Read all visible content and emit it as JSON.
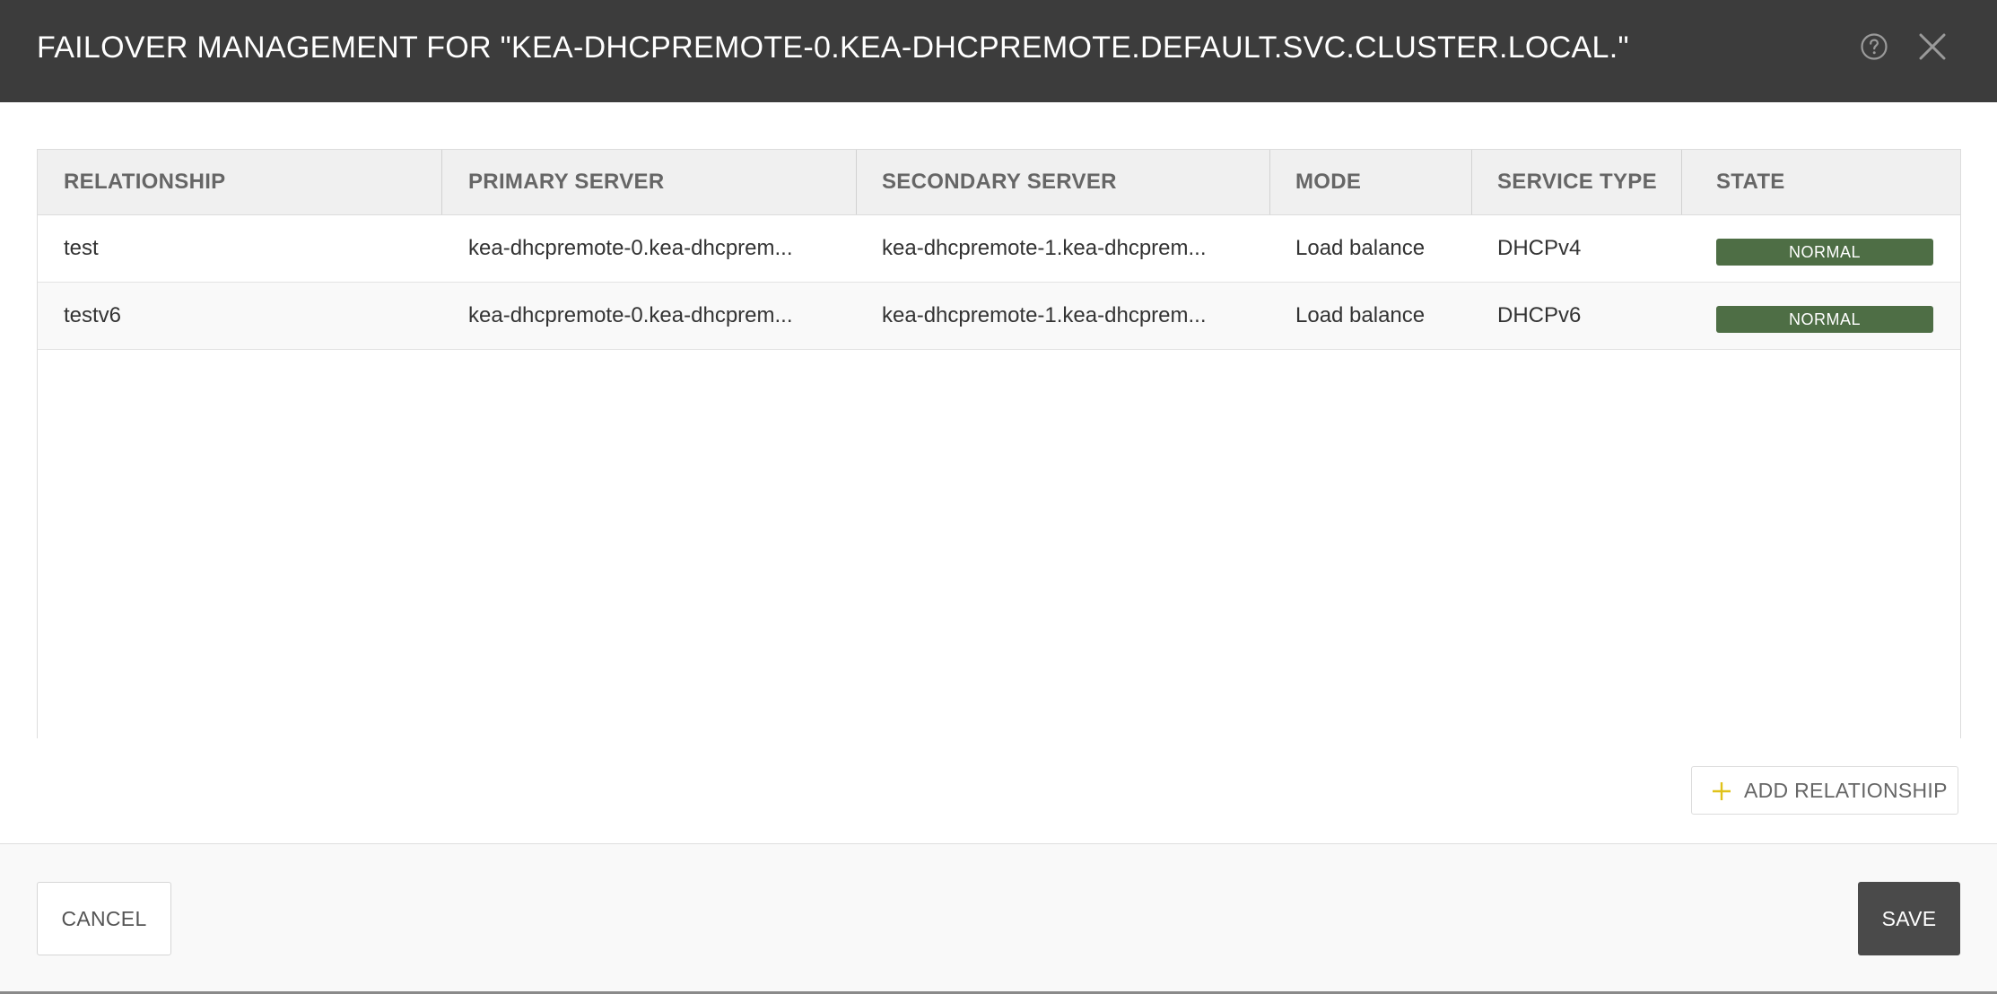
{
  "dialog": {
    "title": "FAILOVER MANAGEMENT FOR \"KEA-DHCPREMOTE-0.KEA-DHCPREMOTE.DEFAULT.SVC.CLUSTER.LOCAL.\"",
    "help_icon": "help-circle-icon",
    "close_icon": "close-icon"
  },
  "table": {
    "columns": [
      "RELATIONSHIP",
      "PRIMARY SERVER",
      "SECONDARY SERVER",
      "MODE",
      "SERVICE TYPE",
      "STATE"
    ],
    "rows": [
      {
        "relationship": "test",
        "primary_server": "kea-dhcpremote-0.kea-dhcprem...",
        "secondary_server": "kea-dhcpremote-1.kea-dhcprem...",
        "mode": "Load balance",
        "service_type": "DHCPv4",
        "state": "NORMAL"
      },
      {
        "relationship": "testv6",
        "primary_server": "kea-dhcpremote-0.kea-dhcprem...",
        "secondary_server": "kea-dhcpremote-1.kea-dhcprem...",
        "mode": "Load balance",
        "service_type": "DHCPv6",
        "state": "NORMAL"
      }
    ]
  },
  "actions": {
    "add_relationship_label": "ADD RELATIONSHIP",
    "add_icon": "plus-icon",
    "cancel_label": "CANCEL",
    "save_label": "SAVE"
  },
  "colors": {
    "header_bg": "#3c3c3c",
    "state_normal": "#4e6e45",
    "plus_accent": "#e0c21a",
    "save_bg": "#4a4a4a"
  }
}
